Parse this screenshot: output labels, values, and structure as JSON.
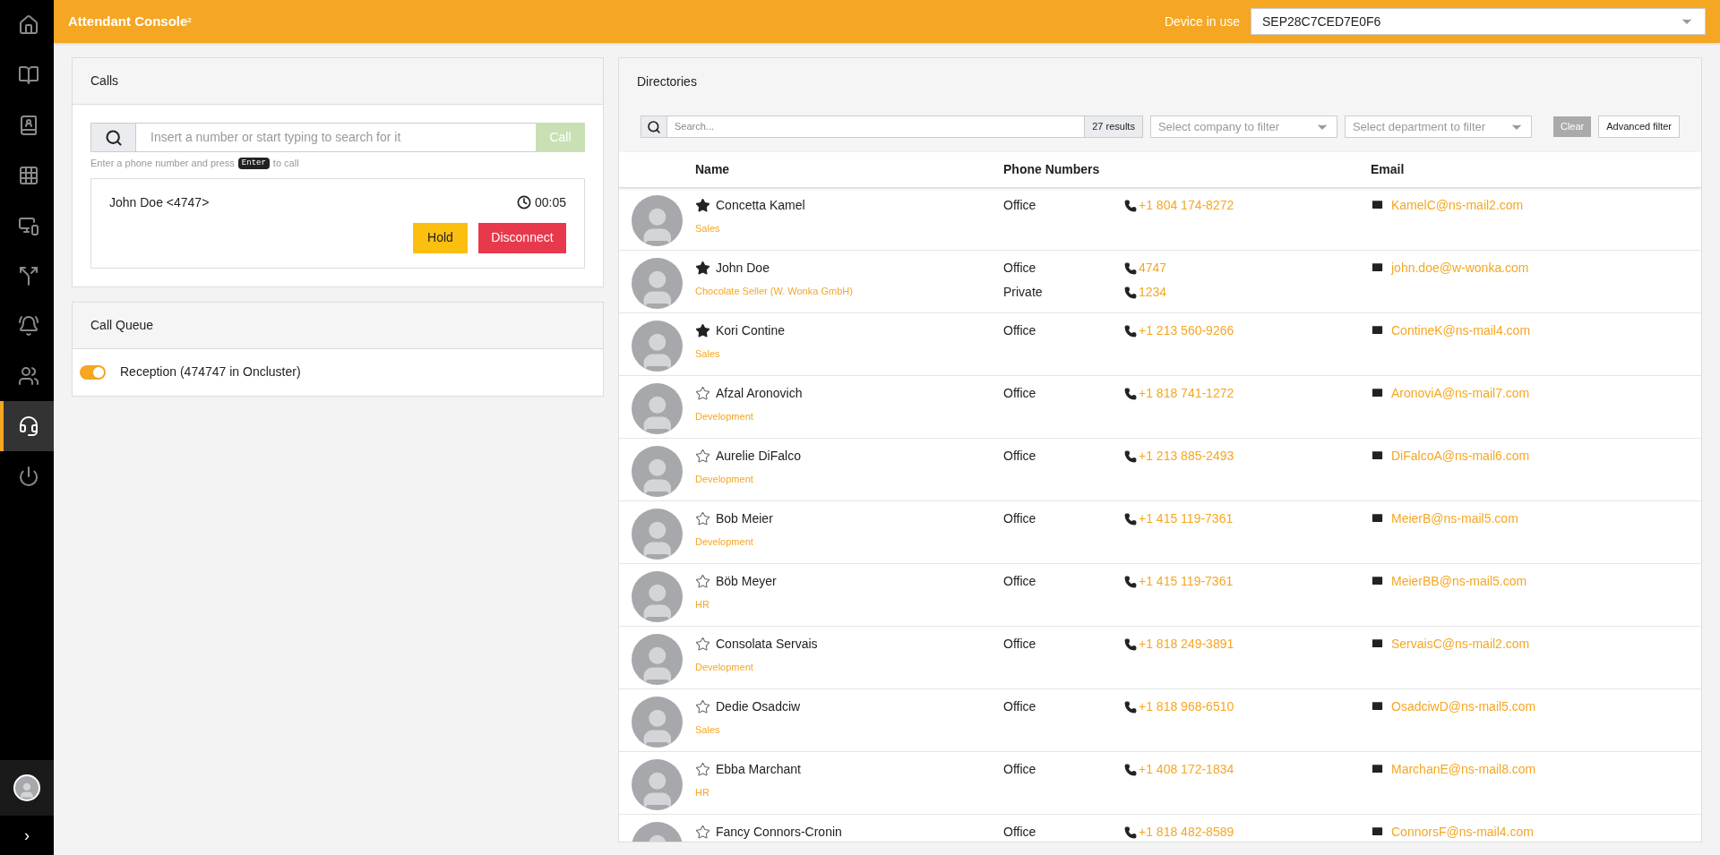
{
  "sidebar": {
    "items": [
      {
        "selected": false
      },
      {
        "selected": false
      },
      {
        "selected": false
      },
      {
        "selected": false
      },
      {
        "selected": false
      },
      {
        "selected": false
      },
      {
        "selected": false
      },
      {
        "selected": false
      },
      {
        "selected": true
      },
      {
        "selected": false
      }
    ],
    "expand": "›"
  },
  "header": {
    "title": "Attendant Console",
    "title_sup": "2",
    "device_label": "Device in use",
    "device_value": "SEP28C7CED7E0F6"
  },
  "calls": {
    "title": "Calls",
    "dial_placeholder": "Insert a number or start typing to search for it",
    "call_button": "Call",
    "hint_before": "Enter a phone number and press",
    "hint_key": "Enter",
    "hint_after": "to call",
    "active_call": {
      "caller": "John Doe <4747>",
      "duration": "00:05",
      "hold": "Hold",
      "disconnect": "Disconnect"
    }
  },
  "call_queue": {
    "title": "Call Queue",
    "queues": [
      {
        "label": "Reception (474747 in Oncluster)",
        "on": true
      }
    ]
  },
  "directories": {
    "title": "Directories",
    "search_placeholder": "Search...",
    "results": "27 results",
    "company_filter": "Select company to filter",
    "department_filter": "Select department to filter",
    "clear": "Clear",
    "advanced": "Advanced filter",
    "columns": [
      "Name",
      "Phone Numbers",
      "Email"
    ],
    "contacts": [
      {
        "name": "Concetta Kamel",
        "favorite": true,
        "department": "Sales",
        "phones": [
          {
            "type": "Office",
            "number": "+1 804 174-8272"
          }
        ],
        "email": "KamelC@ns-mail2.com"
      },
      {
        "name": "John Doe",
        "favorite": true,
        "department": "Chocolate Seller (W. Wonka GmbH)",
        "phones": [
          {
            "type": "Office",
            "number": "4747"
          },
          {
            "type": "Private",
            "number": "1234"
          }
        ],
        "email": "john.doe@w-wonka.com"
      },
      {
        "name": "Kori Contine",
        "favorite": true,
        "department": "Sales",
        "phones": [
          {
            "type": "Office",
            "number": "+1 213 560-9266"
          }
        ],
        "email": "ContineK@ns-mail4.com"
      },
      {
        "name": "Afzal Aronovich",
        "favorite": false,
        "department": "Development",
        "phones": [
          {
            "type": "Office",
            "number": "+1 818 741-1272"
          }
        ],
        "email": "AronoviA@ns-mail7.com"
      },
      {
        "name": "Aurelie DiFalco",
        "favorite": false,
        "department": "Development",
        "phones": [
          {
            "type": "Office",
            "number": "+1 213 885-2493"
          }
        ],
        "email": "DiFalcoA@ns-mail6.com"
      },
      {
        "name": "Bob Meier",
        "favorite": false,
        "department": "Development",
        "phones": [
          {
            "type": "Office",
            "number": "+1 415 119-7361"
          }
        ],
        "email": "MeierB@ns-mail5.com"
      },
      {
        "name": "Böb Meyer",
        "favorite": false,
        "department": "HR",
        "phones": [
          {
            "type": "Office",
            "number": "+1 415 119-7361"
          }
        ],
        "email": "MeierBB@ns-mail5.com"
      },
      {
        "name": "Consolata Servais",
        "favorite": false,
        "department": "Development",
        "phones": [
          {
            "type": "Office",
            "number": "+1 818 249-3891"
          }
        ],
        "email": "ServaisC@ns-mail2.com"
      },
      {
        "name": "Dedie Osadciw",
        "favorite": false,
        "department": "Sales",
        "phones": [
          {
            "type": "Office",
            "number": "+1 818 968-6510"
          }
        ],
        "email": "OsadciwD@ns-mail5.com"
      },
      {
        "name": "Ebba Marchant",
        "favorite": false,
        "department": "HR",
        "phones": [
          {
            "type": "Office",
            "number": "+1 408 172-1834"
          }
        ],
        "email": "MarchanE@ns-mail8.com"
      },
      {
        "name": "Fancy Connors-Cronin",
        "favorite": false,
        "phones": [
          {
            "type": "Office",
            "number": "+1 818 482-8589"
          }
        ],
        "email": "ConnorsF@ns-mail4.com"
      }
    ]
  }
}
